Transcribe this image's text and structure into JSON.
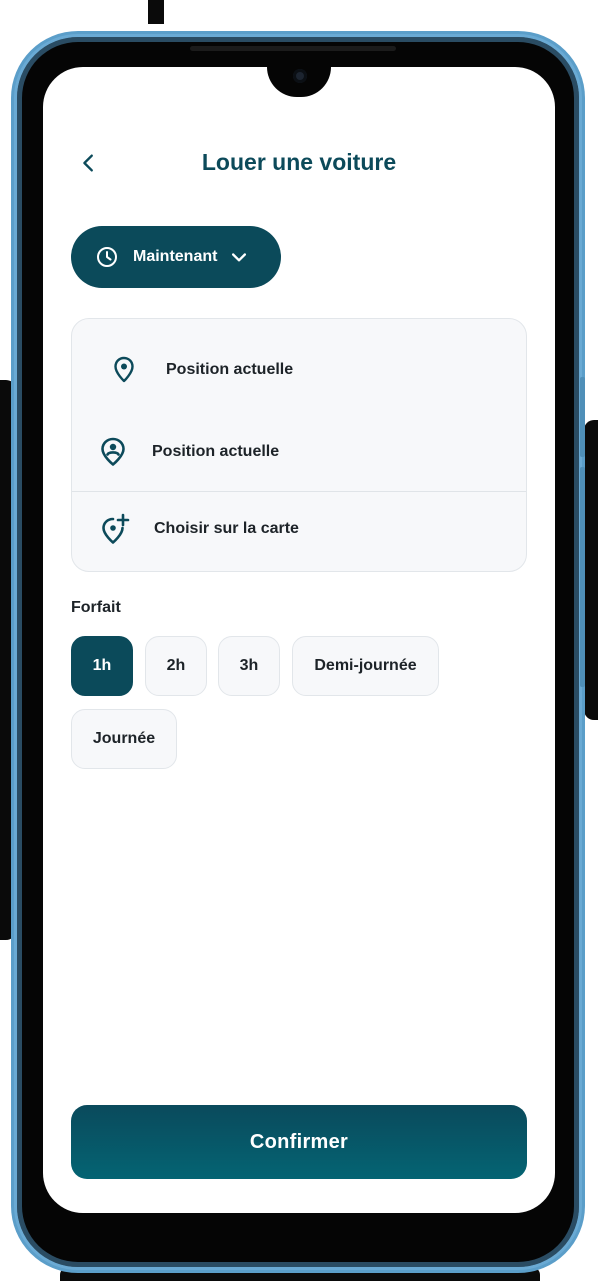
{
  "colors": {
    "primary": "#0b4a5a",
    "accent": "#046473",
    "surface": "#f7f8fa",
    "text": "#1d2328"
  },
  "header": {
    "back_icon": "chevron-left-icon",
    "title": "Louer une voiture"
  },
  "time_selector": {
    "icon": "clock-icon",
    "label": "Maintenant",
    "dropdown_icon": "chevron-down-icon"
  },
  "location_card": {
    "pickup": {
      "icon": "map-pin-icon",
      "label": "Position actuelle"
    },
    "options": [
      {
        "icon": "user-location-icon",
        "label": "Position actuelle"
      },
      {
        "icon": "add-location-icon",
        "label": "Choisir sur la carte"
      }
    ]
  },
  "package": {
    "label": "Forfait",
    "options": [
      {
        "label": "1h",
        "selected": true
      },
      {
        "label": "2h",
        "selected": false
      },
      {
        "label": "3h",
        "selected": false
      },
      {
        "label": "Demi-journée",
        "selected": false
      },
      {
        "label": "Journée",
        "selected": false
      }
    ]
  },
  "confirm_label": "Confirmer"
}
